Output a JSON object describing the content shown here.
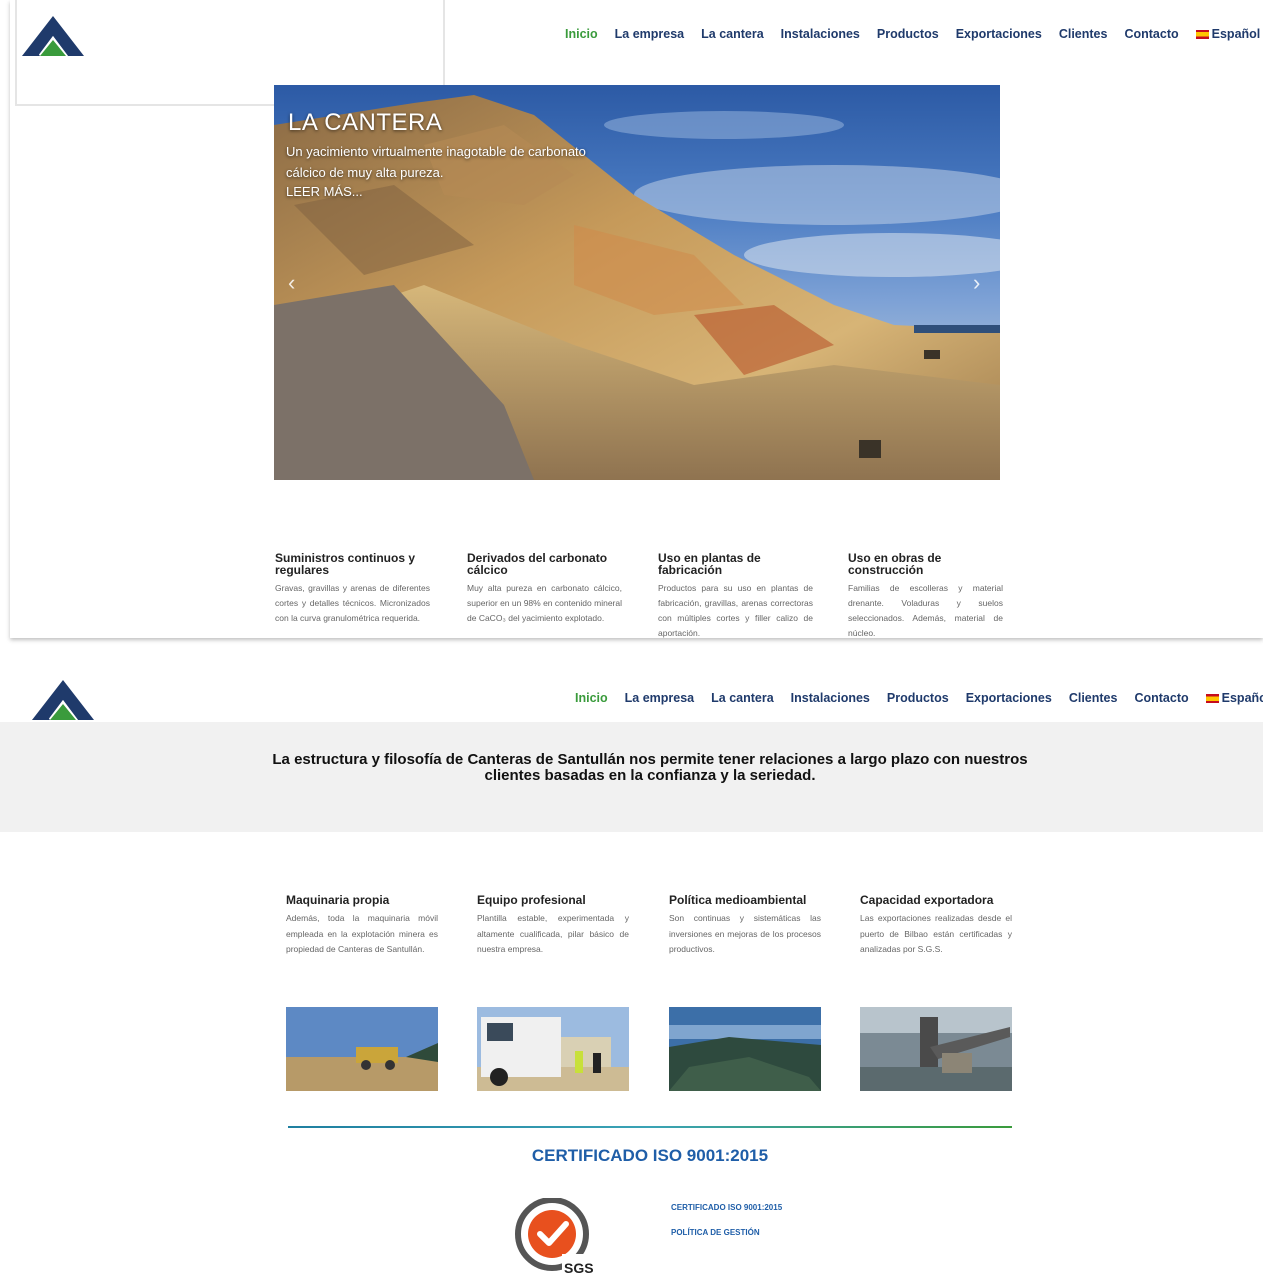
{
  "nav": {
    "items": [
      {
        "label": "Inicio",
        "active": true
      },
      {
        "label": "La empresa"
      },
      {
        "label": "La cantera"
      },
      {
        "label": "Instalaciones"
      },
      {
        "label": "Productos"
      },
      {
        "label": "Exportaciones"
      },
      {
        "label": "Clientes"
      },
      {
        "label": "Contacto"
      }
    ],
    "language": "Español"
  },
  "hero": {
    "title": "LA CANTERA",
    "subtitle": "Un yacimiento virtualmente inagotable de carbonato cálcico de muy alta pureza.",
    "more": "LEER MÁS..."
  },
  "features": [
    {
      "title": "Suministros continuos y regulares",
      "text": "Gravas, gravillas y arenas de diferentes cortes y detalles técnicos. Micronizados con la curva granulométrica requerida."
    },
    {
      "title": "Derivados del carbonato cálcico",
      "text": "Muy alta pureza en carbonato cálcico, superior en un 98% en contenido mineral de CaCO₃ del yacimiento explotado."
    },
    {
      "title": "Uso en plantas de fabricación",
      "text": "Productos para su uso en plantas de fabricación, gravillas, arenas correctoras con múltiples cortes y filler calizo de aportación."
    },
    {
      "title": "Uso en obras de construcción",
      "text": "Familias de escolleras y material drenante. Voladuras y suelos seleccionados. Además, material de núcleo."
    }
  ],
  "statement": "La estructura y filosofía de Canteras de Santullán nos permite tener relaciones a largo plazo con nuestros clientes basadas en la confianza y la seriedad.",
  "columns": [
    {
      "title": "Maquinaria propia",
      "text": "Además, toda la maquinaria móvil empleada en la explotación minera es propiedad de Canteras de Santullán."
    },
    {
      "title": "Equipo profesional",
      "text": "Plantilla estable, experimentada y altamente cualificada, pilar básico de nuestra empresa."
    },
    {
      "title": "Política medioambiental",
      "text": "Son continuas y sistemáticas las inversiones en mejoras de los procesos productivos."
    },
    {
      "title": "Capacidad exportadora",
      "text": "Las exportaciones realizadas desde el puerto de Bilbao están certificadas y analizadas por S.G.S."
    }
  ],
  "certificate": {
    "title": "CERTIFICADO ISO 9001:2015",
    "links": [
      "CERTIFICADO ISO 9001:2015",
      "POLÍTICA DE GESTIÓN"
    ],
    "badge": "SGS"
  },
  "colors": {
    "nav_blue": "#1f3a6b",
    "nav_active_green": "#3a9b3c",
    "cert_blue": "#1f5ea8",
    "sgs_orange": "#e8501e"
  },
  "icons": [
    "company-logo",
    "chevron-left-icon",
    "chevron-right-icon",
    "spain-flag-icon",
    "chevron-down-icon",
    "sgs-certification-badge"
  ]
}
